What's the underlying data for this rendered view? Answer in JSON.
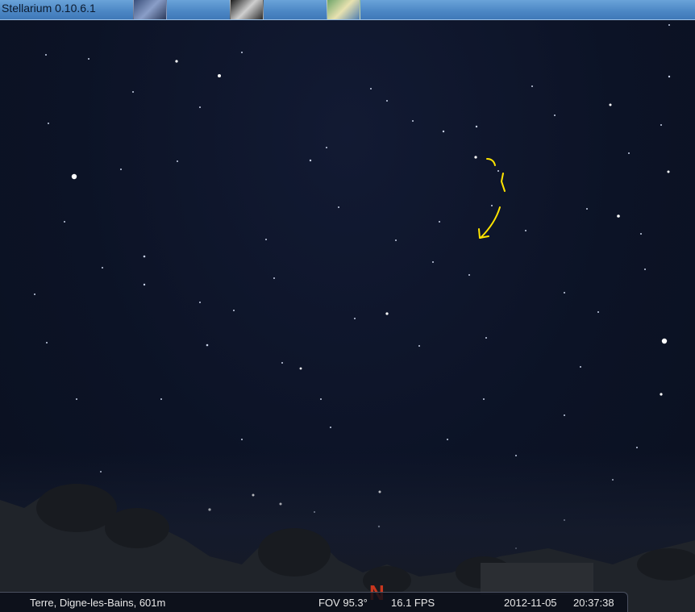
{
  "window": {
    "title": "Stellarium 0.10.6.1"
  },
  "compass": {
    "cardinal_north": "N"
  },
  "status": {
    "location": "Terre, Digne-les-Bains, 601m",
    "fov": "FOV 95.3°",
    "fps": "16.1 FPS",
    "date": "2012-11-05",
    "time": "20:37:38"
  },
  "colors": {
    "sky": "#0c1326",
    "annotation": "#ffe400",
    "cardinal": "#c8371e"
  }
}
